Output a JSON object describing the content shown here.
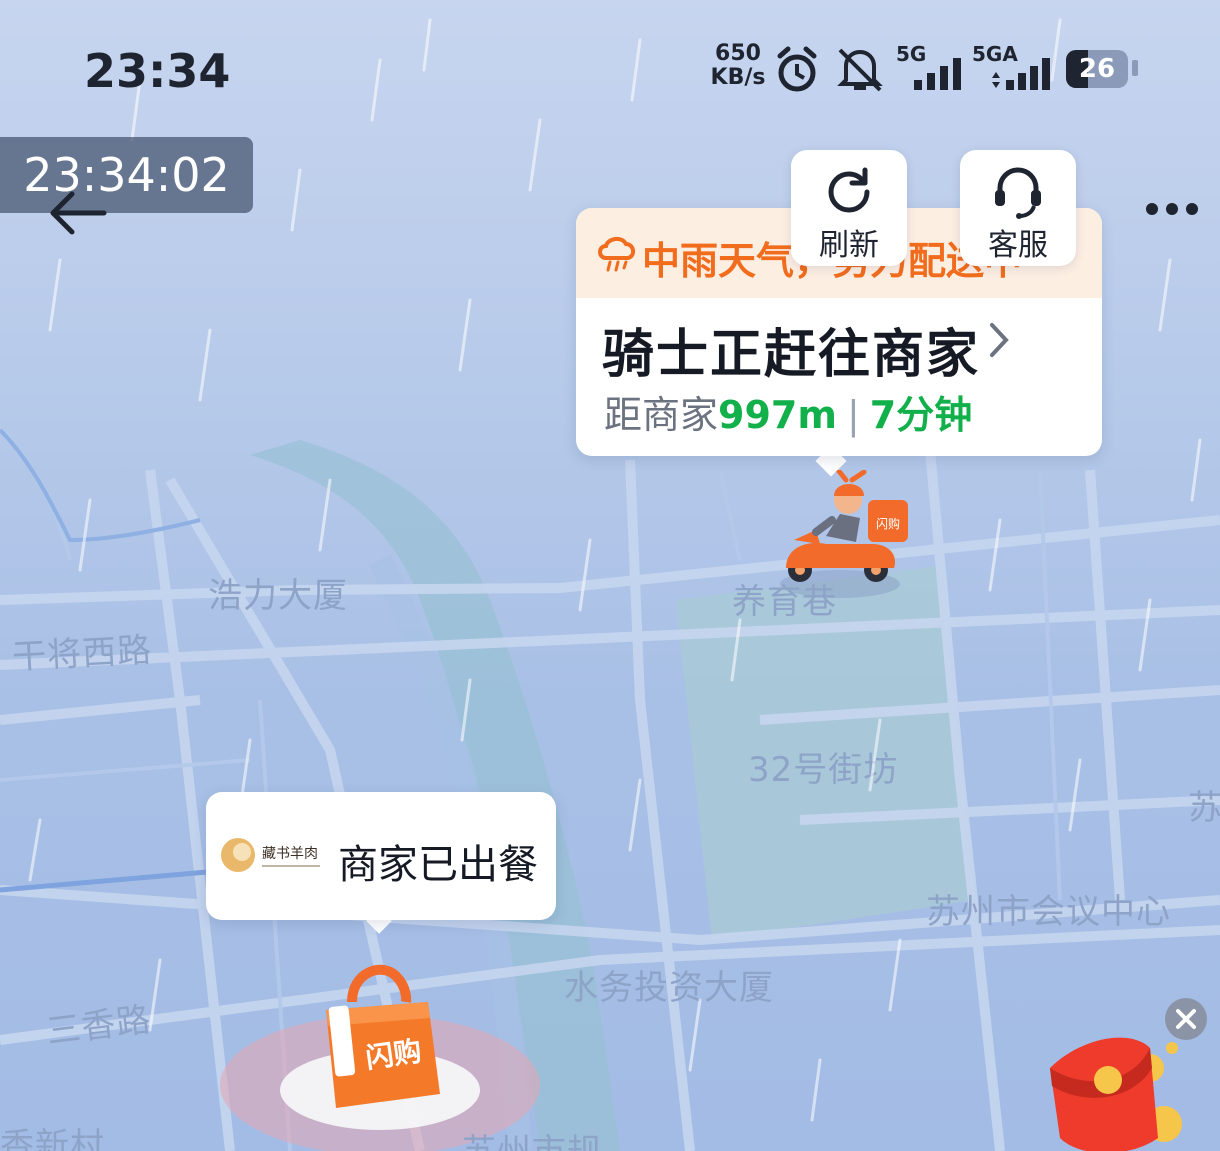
{
  "status_bar": {
    "time": "23:34",
    "net_speed_value": "650",
    "net_speed_unit": "KB/s",
    "signal_1": "5G",
    "signal_2": "5GA",
    "battery": "26",
    "icons": [
      "alarm-icon",
      "mute-icon",
      "signal-icon",
      "battery-icon"
    ]
  },
  "timestamp": "23:34:02",
  "actions": {
    "refresh_label": "刷新",
    "service_label": "客服"
  },
  "status_card": {
    "weather_notice": "中雨天气，努力配送中",
    "title": "骑士正赶往商家",
    "distance_prefix": "距商家",
    "distance": "997m",
    "eta": "7分钟"
  },
  "merchant": {
    "logo_text": "藏书羊肉",
    "status": "商家已出餐"
  },
  "map_labels": {
    "haoli": "浩力大厦",
    "ganjiang": "干将西路",
    "yangyu": "养育巷",
    "block32": "32号街坊",
    "conference": "苏州市会议中心",
    "shuiwu": "水务投资大厦",
    "sanxiang": "三香路",
    "xiangxin": "香新村",
    "suzhou": "苏州市规",
    "right_edge": "苏"
  },
  "markers": {
    "rider_box": "闪购",
    "bag_label": "闪购"
  },
  "colors": {
    "accent_orange": "#f16c1c",
    "green": "#12b04a",
    "map_bg": "#b8cbea"
  }
}
